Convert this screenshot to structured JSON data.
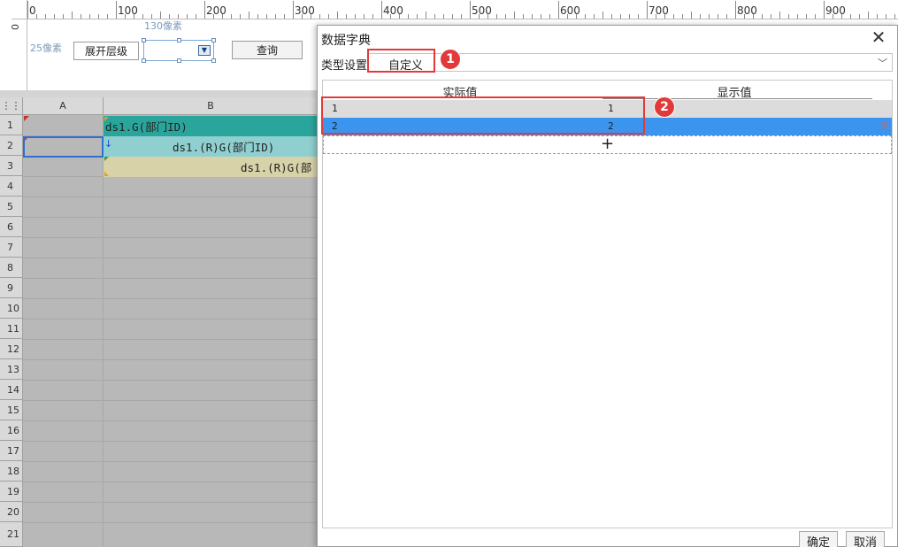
{
  "ruler": {
    "h_labels": [
      "0",
      "100",
      "200",
      "300",
      "400",
      "500",
      "600",
      "700",
      "800",
      "900"
    ],
    "v_label": "0"
  },
  "form": {
    "width_hint": "130像素",
    "height_hint": "25像素",
    "expand_level_label": "展开层级",
    "query_button": "查询"
  },
  "sheet": {
    "columns": [
      "A",
      "B"
    ],
    "rows": [
      "1",
      "2",
      "3",
      "4",
      "5",
      "6",
      "7",
      "8",
      "9",
      "10",
      "11",
      "12",
      "13",
      "14",
      "15",
      "16",
      "17",
      "18",
      "19",
      "20",
      "21"
    ],
    "cells": {
      "b1": "ds1.G(部门ID)",
      "b2": "ds1.(R)G(部门ID)",
      "b3": "ds1.(R)G(部"
    },
    "colors": {
      "b1": "#2aa59b",
      "b2": "#8fcfcf",
      "b3": "#d7d2a8"
    }
  },
  "dialog": {
    "title": "数据字典",
    "type_label": "类型设置",
    "type_value": "自定义",
    "columns": {
      "actual": "实际值",
      "display": "显示值"
    },
    "rows": [
      {
        "actual_index": "1",
        "actual_value": "1"
      },
      {
        "actual_index": "2",
        "actual_value": "2"
      }
    ],
    "add_symbol": "+",
    "ok_button": "确定",
    "cancel_button": "取消",
    "selected_row_color": "#3b95ef"
  },
  "annotations": {
    "badge1": "1",
    "badge2": "2",
    "color": "#e23a3a"
  }
}
